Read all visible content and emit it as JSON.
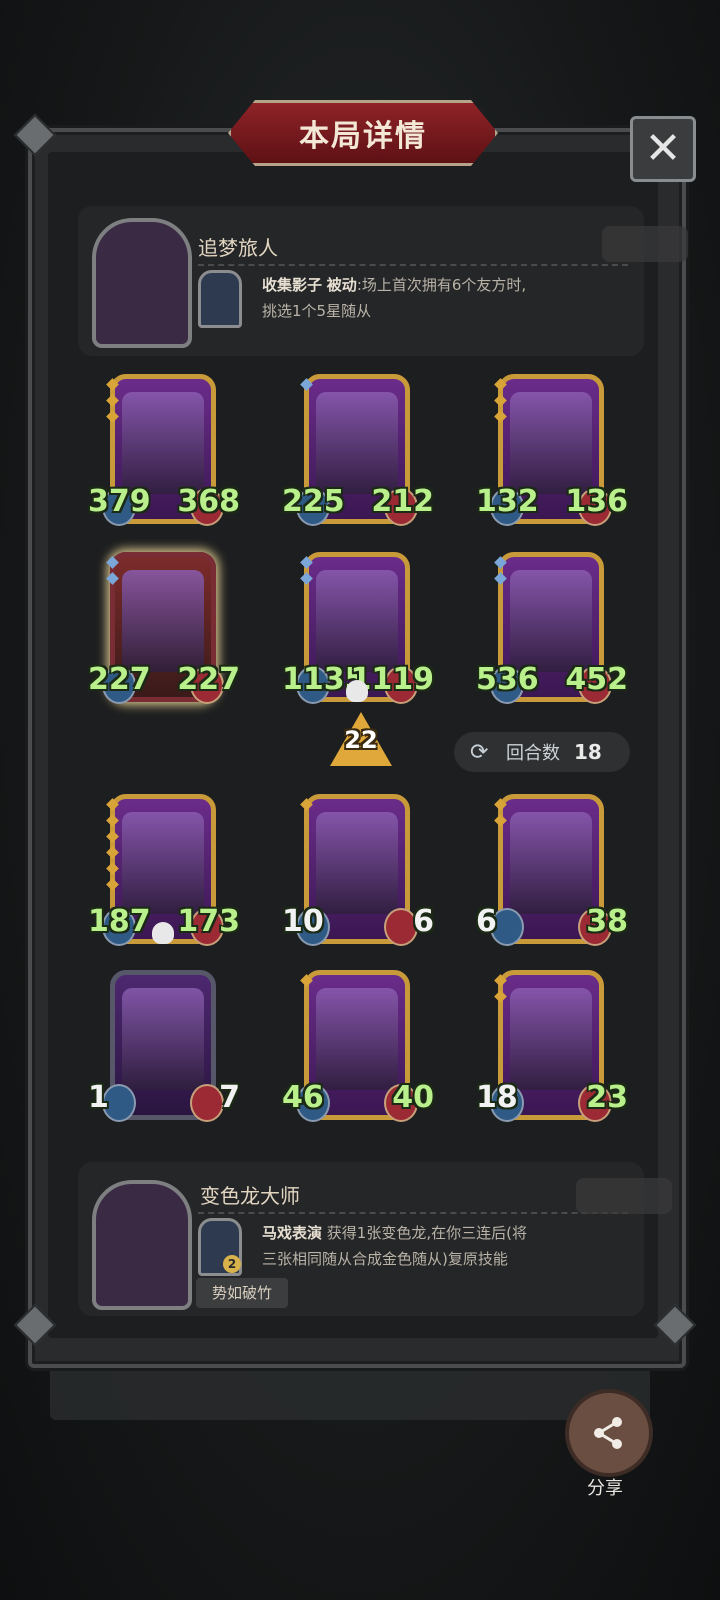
{
  "title": "本局详情",
  "top_hero": {
    "name": "追梦旅人",
    "skill_name": "收集影子",
    "skill_type": "被动",
    "skill_desc_line1": ":场上首次拥有6个友方时,",
    "skill_desc_line2": "挑选1个5星随从"
  },
  "cards_row1": [
    {
      "atk": "379",
      "hp": "368",
      "stars": 3,
      "star_color": "gold"
    },
    {
      "atk": "225",
      "hp": "212",
      "stars": 1,
      "star_color": "blue"
    },
    {
      "atk": "132",
      "hp": "136",
      "stars": 3,
      "star_color": "gold"
    }
  ],
  "cards_row2": [
    {
      "atk": "227",
      "hp": "227",
      "stars": 2,
      "star_color": "blue"
    },
    {
      "atk": "1135",
      "hp": "1119",
      "stars": 2,
      "star_color": "blue"
    },
    {
      "atk": "536",
      "hp": "452",
      "stars": 2,
      "star_color": "blue"
    }
  ],
  "level": "22",
  "round": {
    "label": "回合数",
    "value": "18"
  },
  "cards_row3": [
    {
      "atk": "187",
      "hp": "173",
      "stars": 6,
      "star_color": "gold"
    },
    {
      "atk": "10",
      "hp": "6",
      "stars": 1,
      "star_color": "gold"
    },
    {
      "atk": "6",
      "hp": "38",
      "stars": 2,
      "star_color": "gold"
    }
  ],
  "cards_row4": [
    {
      "atk": "1",
      "hp": "7",
      "stars": 0,
      "star_color": "gold"
    },
    {
      "atk": "46",
      "hp": "40",
      "stars": 1,
      "star_color": "gold"
    },
    {
      "atk": "18",
      "hp": "23",
      "stars": 2,
      "star_color": "gold"
    }
  ],
  "bottom_hero": {
    "name": "变色龙大师",
    "skill_name": "马戏表演",
    "skill_desc_line1": "获得1张变色龙,在你三连后(将",
    "skill_desc_line2": "三张相同随从合成金色随从)复原技能",
    "badge": "2",
    "tag": "势如破竹"
  },
  "share_label": "分享",
  "close_icon": "close-icon",
  "share_icon": "share-icon",
  "colors": {
    "title_red": "#8e2328",
    "gold_frame": "#c99a3a",
    "stat_green": "#b9f08c",
    "level_gold": "#e0a73a"
  }
}
